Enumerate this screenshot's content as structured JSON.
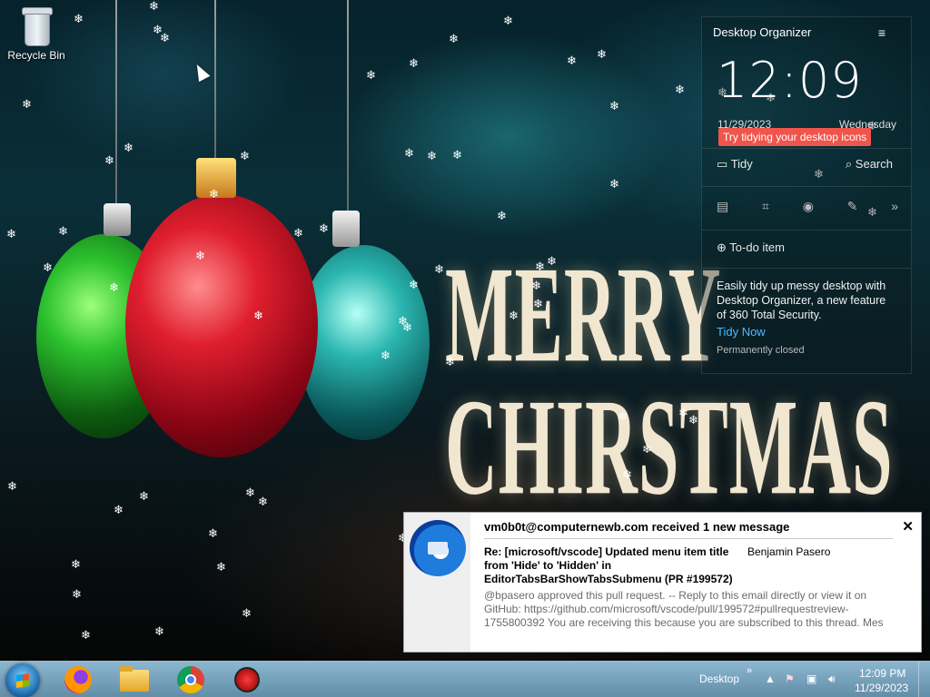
{
  "desktop": {
    "recycle_bin_label": "Recycle Bin",
    "wallpaper_line1": "MERRY",
    "wallpaper_line2": "CHIRSTMAS"
  },
  "organizer": {
    "title": "Desktop Organizer",
    "menu_icon": "hamburger-menu-icon",
    "time": "12:09",
    "date": "11/29/2023",
    "weekday": "Wednesday",
    "tip": "Try tidying your desktop icons",
    "tidy_label": "Tidy",
    "search_label": "Search",
    "todo_label": "To-do item",
    "promo_text": "Easily tidy up messy desktop with Desktop Organizer, a new feature of 360 Total Security.",
    "tidy_now": "Tidy Now",
    "permanently_closed": "Permanently closed"
  },
  "notification": {
    "heading": "vm0b0t@computernewb.com received 1 new message",
    "subject": "Re: [microsoft/vscode] Updated menu item title from 'Hide' to 'Hidden' in EditorTabsBarShowTabsSubmenu (PR #199572)",
    "sender": "Benjamin Pasero",
    "preview": "@bpasero approved this pull request. -- Reply to this email directly or view it on GitHub: https://github.com/microsoft/vscode/pull/199572#pullrequestreview-1755800392 You are receiving this because you are subscribed to this thread. Mes",
    "close_glyph": "✕"
  },
  "taskbar": {
    "desktop_label": "Desktop",
    "chevron": "»",
    "clock_time": "12:09 PM",
    "clock_date": "11/29/2023",
    "apps": [
      "firefox-icon",
      "file-explorer-icon",
      "chrome-icon",
      "360-total-security-icon"
    ]
  }
}
